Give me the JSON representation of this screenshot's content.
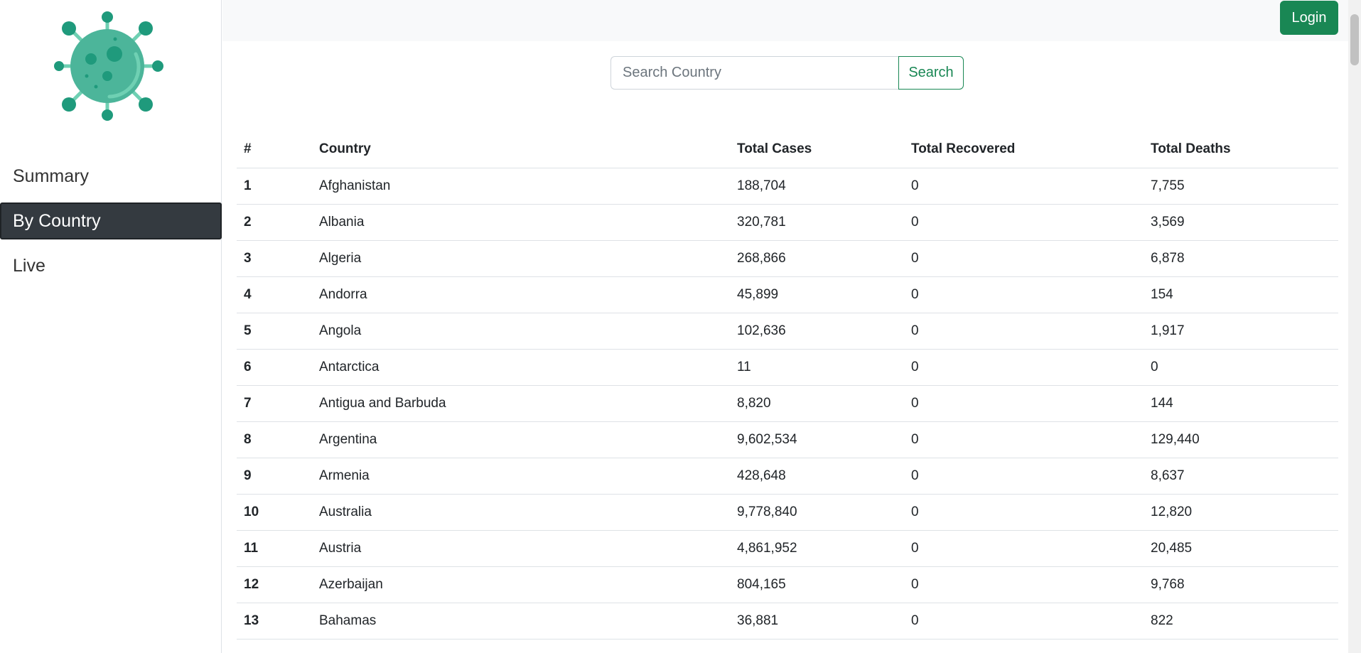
{
  "brand": {
    "logo_icon": "virus-icon",
    "colors": {
      "primary": "#4cb59a",
      "dark": "#1f9a7c",
      "light": "#6fd0b3"
    }
  },
  "sidebar": {
    "items": [
      {
        "label": "Summary",
        "active": false
      },
      {
        "label": "By Country",
        "active": true
      },
      {
        "label": "Live",
        "active": false
      }
    ]
  },
  "header": {
    "login_label": "Login"
  },
  "search": {
    "placeholder": "Search Country",
    "value": "",
    "button_label": "Search"
  },
  "table": {
    "headers": [
      "#",
      "Country",
      "Total Cases",
      "Total Recovered",
      "Total Deaths"
    ],
    "rows": [
      [
        "1",
        "Afghanistan",
        "188,704",
        "0",
        "7,755"
      ],
      [
        "2",
        "Albania",
        "320,781",
        "0",
        "3,569"
      ],
      [
        "3",
        "Algeria",
        "268,866",
        "0",
        "6,878"
      ],
      [
        "4",
        "Andorra",
        "45,899",
        "0",
        "154"
      ],
      [
        "5",
        "Angola",
        "102,636",
        "0",
        "1,917"
      ],
      [
        "6",
        "Antarctica",
        "11",
        "0",
        "0"
      ],
      [
        "7",
        "Antigua and Barbuda",
        "8,820",
        "0",
        "144"
      ],
      [
        "8",
        "Argentina",
        "9,602,534",
        "0",
        "129,440"
      ],
      [
        "9",
        "Armenia",
        "428,648",
        "0",
        "8,637"
      ],
      [
        "10",
        "Australia",
        "9,778,840",
        "0",
        "12,820"
      ],
      [
        "11",
        "Austria",
        "4,861,952",
        "0",
        "20,485"
      ],
      [
        "12",
        "Azerbaijan",
        "804,165",
        "0",
        "9,768"
      ],
      [
        "13",
        "Bahamas",
        "36,881",
        "0",
        "822"
      ]
    ]
  }
}
